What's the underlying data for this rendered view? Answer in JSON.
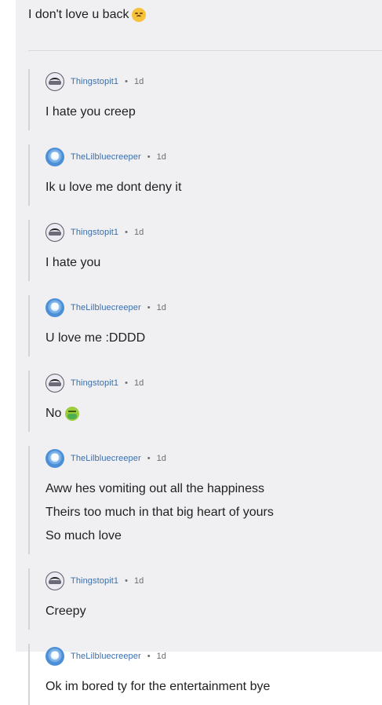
{
  "top_message": {
    "text": "I don't love u back",
    "emoji": "sad-face-emoji"
  },
  "comments": [
    {
      "user": "Thingstopit1",
      "time": "1d",
      "avatar": "face-avatar",
      "lines": [
        "I hate you creep"
      ]
    },
    {
      "user": "TheLilbluecreeper",
      "time": "1d",
      "avatar": "blue-avatar",
      "lines": [
        "Ik u love me dont deny it"
      ]
    },
    {
      "user": "Thingstopit1",
      "time": "1d",
      "avatar": "face-avatar",
      "lines": [
        "I hate you"
      ]
    },
    {
      "user": "TheLilbluecreeper",
      "time": "1d",
      "avatar": "blue-avatar",
      "lines": [
        "U love me :DDDD"
      ]
    },
    {
      "user": "Thingstopit1",
      "time": "1d",
      "avatar": "face-avatar",
      "lines": [
        "No"
      ],
      "emoji": "nauseated-face-emoji"
    },
    {
      "user": "TheLilbluecreeper",
      "time": "1d",
      "avatar": "blue-avatar",
      "lines": [
        "Aww hes vomiting out all the happiness",
        "Theirs too much in that big heart of yours",
        "So much love"
      ]
    },
    {
      "user": "Thingstopit1",
      "time": "1d",
      "avatar": "face-avatar",
      "lines": [
        "Creepy"
      ]
    },
    {
      "user": "TheLilbluecreeper",
      "time": "1d",
      "avatar": "blue-avatar",
      "lines": [
        "Ok im bored ty for the entertainment bye"
      ]
    }
  ],
  "separator": "•"
}
